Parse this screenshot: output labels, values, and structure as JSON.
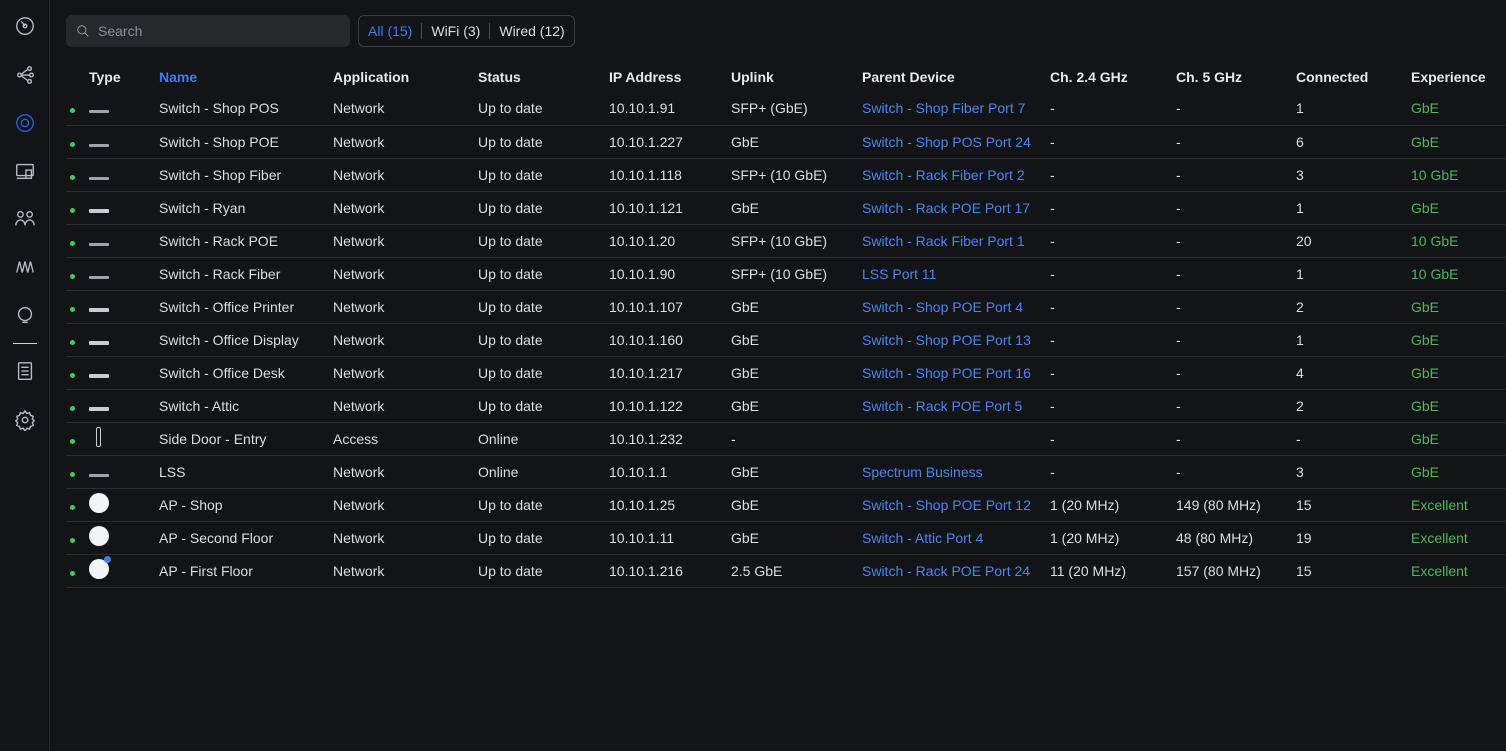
{
  "search": {
    "placeholder": "Search"
  },
  "filters": [
    {
      "label": "All (15)",
      "active": true
    },
    {
      "label": "WiFi (3)",
      "active": false
    },
    {
      "label": "Wired (12)",
      "active": false
    }
  ],
  "nav": [
    "dashboard-icon",
    "topology-icon",
    "devices-icon",
    "clients-icon",
    "client-devices-icon",
    "insights-icon",
    "innerspace-icon",
    "logs-icon",
    "settings-icon"
  ],
  "columns": [
    "Type",
    "Name",
    "Application",
    "Status",
    "IP Address",
    "Uplink",
    "Parent Device",
    "Ch. 2.4 GHz",
    "Ch. 5 GHz",
    "Connected",
    "Experience"
  ],
  "rows": [
    {
      "type": "switch",
      "name": "Switch - Shop POS",
      "app": "Network",
      "status": "Up to date",
      "ip": "10.10.1.91",
      "uplink": "SFP+ (GbE)",
      "parent": "Switch - Shop Fiber Port 7",
      "ch24": "-",
      "ch5": "-",
      "connected": "1",
      "experience": "GbE"
    },
    {
      "type": "switch",
      "name": "Switch - Shop POE",
      "app": "Network",
      "status": "Up to date",
      "ip": "10.10.1.227",
      "uplink": "GbE",
      "parent": "Switch - Shop POS Port 24",
      "ch24": "-",
      "ch5": "-",
      "connected": "6",
      "experience": "GbE"
    },
    {
      "type": "switch",
      "name": "Switch - Shop Fiber",
      "app": "Network",
      "status": "Up to date",
      "ip": "10.10.1.118",
      "uplink": "SFP+ (10 GbE)",
      "parent": "Switch - Rack Fiber Port 2",
      "ch24": "-",
      "ch5": "-",
      "connected": "3",
      "experience": "10 GbE"
    },
    {
      "type": "switch-wide",
      "name": "Switch - Ryan",
      "app": "Network",
      "status": "Up to date",
      "ip": "10.10.1.121",
      "uplink": "GbE",
      "parent": "Switch - Rack POE Port 17",
      "ch24": "-",
      "ch5": "-",
      "connected": "1",
      "experience": "GbE"
    },
    {
      "type": "switch",
      "name": "Switch - Rack POE",
      "app": "Network",
      "status": "Up to date",
      "ip": "10.10.1.20",
      "uplink": "SFP+ (10 GbE)",
      "parent": "Switch - Rack Fiber Port 1",
      "ch24": "-",
      "ch5": "-",
      "connected": "20",
      "experience": "10 GbE"
    },
    {
      "type": "switch",
      "name": "Switch - Rack Fiber",
      "app": "Network",
      "status": "Up to date",
      "ip": "10.10.1.90",
      "uplink": "SFP+ (10 GbE)",
      "parent": "LSS Port 11",
      "ch24": "-",
      "ch5": "-",
      "connected": "1",
      "experience": "10 GbE"
    },
    {
      "type": "switch-wide",
      "name": "Switch - Office Printer",
      "app": "Network",
      "status": "Up to date",
      "ip": "10.10.1.107",
      "uplink": "GbE",
      "parent": "Switch - Shop POE Port 4",
      "ch24": "-",
      "ch5": "-",
      "connected": "2",
      "experience": "GbE"
    },
    {
      "type": "switch-wide",
      "name": "Switch - Office Display",
      "app": "Network",
      "status": "Up to date",
      "ip": "10.10.1.160",
      "uplink": "GbE",
      "parent": "Switch - Shop POE Port 13",
      "ch24": "-",
      "ch5": "-",
      "connected": "1",
      "experience": "GbE"
    },
    {
      "type": "switch-wide",
      "name": "Switch - Office Desk",
      "app": "Network",
      "status": "Up to date",
      "ip": "10.10.1.217",
      "uplink": "GbE",
      "parent": "Switch - Shop POE Port 16",
      "ch24": "-",
      "ch5": "-",
      "connected": "4",
      "experience": "GbE"
    },
    {
      "type": "switch-wide",
      "name": "Switch - Attic",
      "app": "Network",
      "status": "Up to date",
      "ip": "10.10.1.122",
      "uplink": "GbE",
      "parent": "Switch - Rack POE Port 5",
      "ch24": "-",
      "ch5": "-",
      "connected": "2",
      "experience": "GbE"
    },
    {
      "type": "access",
      "name": "Side Door - Entry",
      "app": "Access",
      "status": "Online",
      "ip": "10.10.1.232",
      "uplink": "-",
      "parent": "",
      "ch24": "-",
      "ch5": "-",
      "connected": "-",
      "experience": "GbE"
    },
    {
      "type": "switch",
      "name": "LSS",
      "app": "Network",
      "status": "Online",
      "ip": "10.10.1.1",
      "uplink": "GbE",
      "parent": "Spectrum Business",
      "ch24": "-",
      "ch5": "-",
      "connected": "3",
      "experience": "GbE"
    },
    {
      "type": "ap",
      "name": "AP - Shop",
      "app": "Network",
      "status": "Up to date",
      "ip": "10.10.1.25",
      "uplink": "GbE",
      "parent": "Switch - Shop POE Port 12",
      "ch24": "1 (20 MHz)",
      "ch5": "149 (80 MHz)",
      "connected": "15",
      "experience": "Excellent"
    },
    {
      "type": "ap",
      "name": "AP - Second Floor",
      "app": "Network",
      "status": "Up to date",
      "ip": "10.10.1.11",
      "uplink": "GbE",
      "parent": "Switch - Attic Port 4",
      "ch24": "1 (20 MHz)",
      "ch5": "48 (80 MHz)",
      "connected": "19",
      "experience": "Excellent"
    },
    {
      "type": "ap-badge",
      "name": "AP - First Floor",
      "app": "Network",
      "status": "Up to date",
      "ip": "10.10.1.216",
      "uplink": "2.5 GbE",
      "parent": "Switch - Rack POE Port 24",
      "ch24": "11 (20 MHz)",
      "ch5": "157 (80 MHz)",
      "connected": "15",
      "experience": "Excellent"
    }
  ],
  "colors": {
    "accent": "#3f7df0",
    "online": "#3ccf5a",
    "experience": "#4cb85a",
    "link": "#4a86f2"
  }
}
